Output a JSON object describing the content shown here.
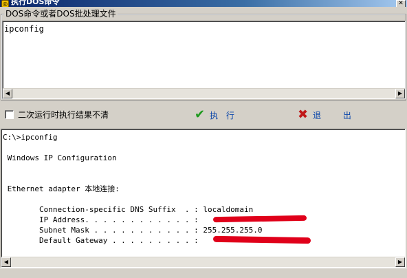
{
  "window": {
    "title": "执行DOS命令",
    "icon": "app-icon",
    "close_glyph": "✕"
  },
  "command_group": {
    "legend": "DOS命令或者DOS批处理文件",
    "input_value": "ipconfig"
  },
  "scrollbar": {
    "left_arrow": "◀",
    "right_arrow": "▶"
  },
  "options": {
    "checkbox_label": "二次运行时执行结果不清",
    "checkbox_checked": false
  },
  "buttons": {
    "run_icon": "✔",
    "run_label": "执 行",
    "exit_icon": "✖",
    "exit_label": "退 出"
  },
  "output": {
    "text": "C:\\>ipconfig\n\n Windows IP Configuration\n\n\n Ethernet adapter 本地连接:\n\n        Connection-specific DNS Suffix  . : localdomain\n        IP Address. . . . . . . . . . . . :\n        Subnet Mask . . . . . . . . . . . : 255.255.255.0\n        Default Gateway . . . . . . . . . :"
  },
  "colors": {
    "run_icon": "#1f9a1f",
    "exit_icon": "#c01818",
    "button_label": "#0a46aa",
    "redaction": "#e0001a"
  }
}
